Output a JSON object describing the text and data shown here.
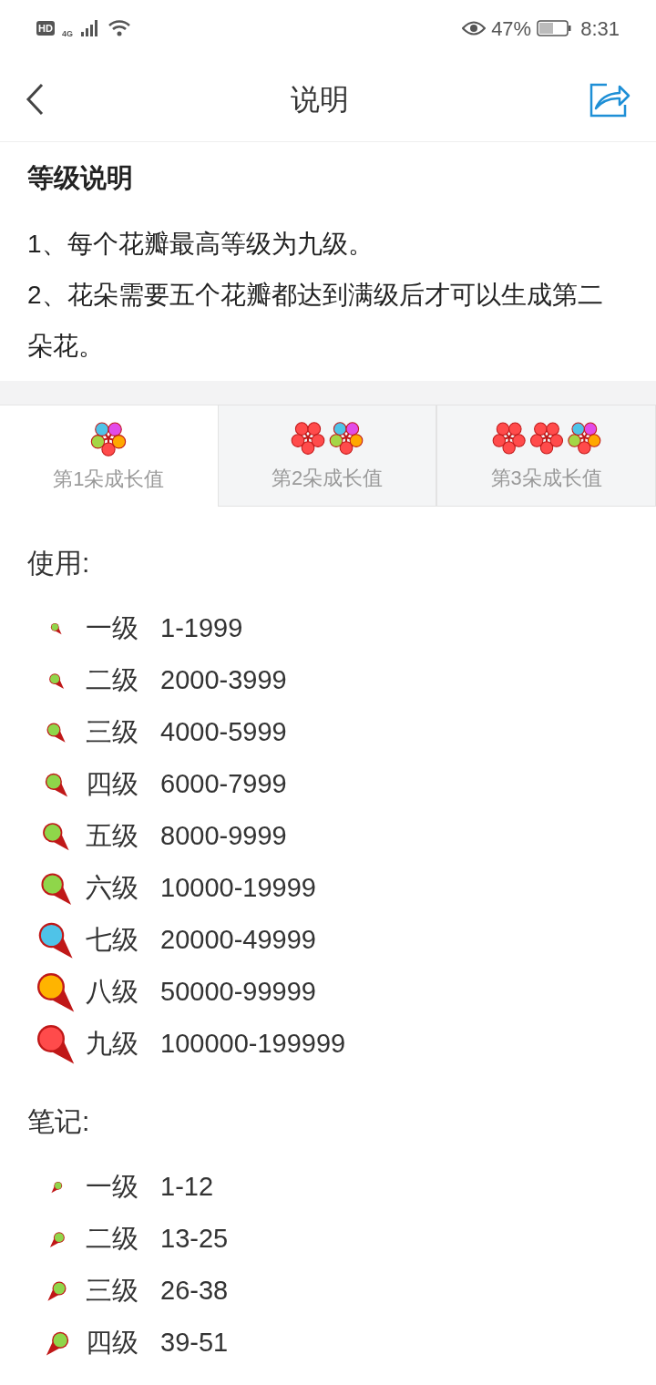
{
  "status_bar": {
    "hd": "HD",
    "network": "4G",
    "battery_percent": "47%",
    "time": "8:31"
  },
  "header": {
    "title": "说明"
  },
  "intro": {
    "title": "等级说明",
    "lines": [
      "1、每个花瓣最高等级为九级。",
      "2、花朵需要五个花瓣都达到满级后才可以生成第二朵花。"
    ]
  },
  "tabs": [
    {
      "label": "第1朵成长值",
      "selected": true
    },
    {
      "label": "第2朵成长值",
      "selected": false
    },
    {
      "label": "第3朵成长值",
      "selected": false
    }
  ],
  "sections": [
    {
      "title": "使用:",
      "kind": "usage",
      "levels": [
        {
          "name": "一级",
          "range": "1-1999",
          "color": "#8fd64a"
        },
        {
          "name": "二级",
          "range": "2000-3999",
          "color": "#8fd64a"
        },
        {
          "name": "三级",
          "range": "4000-5999",
          "color": "#8fd64a"
        },
        {
          "name": "四级",
          "range": "6000-7999",
          "color": "#8fd64a"
        },
        {
          "name": "五级",
          "range": "8000-9999",
          "color": "#8fd64a"
        },
        {
          "name": "六级",
          "range": "10000-19999",
          "color": "#8fd64a"
        },
        {
          "name": "七级",
          "range": "20000-49999",
          "color": "#4fc3e8"
        },
        {
          "name": "八级",
          "range": "50000-99999",
          "color": "#ffb400"
        },
        {
          "name": "九级",
          "range": "100000-199999",
          "color": "#ff4b4b"
        }
      ]
    },
    {
      "title": "笔记:",
      "kind": "notes",
      "levels": [
        {
          "name": "一级",
          "range": "1-12",
          "color": "#8fd64a"
        },
        {
          "name": "二级",
          "range": "13-25",
          "color": "#8fd64a"
        },
        {
          "name": "三级",
          "range": "26-38",
          "color": "#8fd64a"
        },
        {
          "name": "四级",
          "range": "39-51",
          "color": "#8fd64a"
        }
      ]
    }
  ]
}
